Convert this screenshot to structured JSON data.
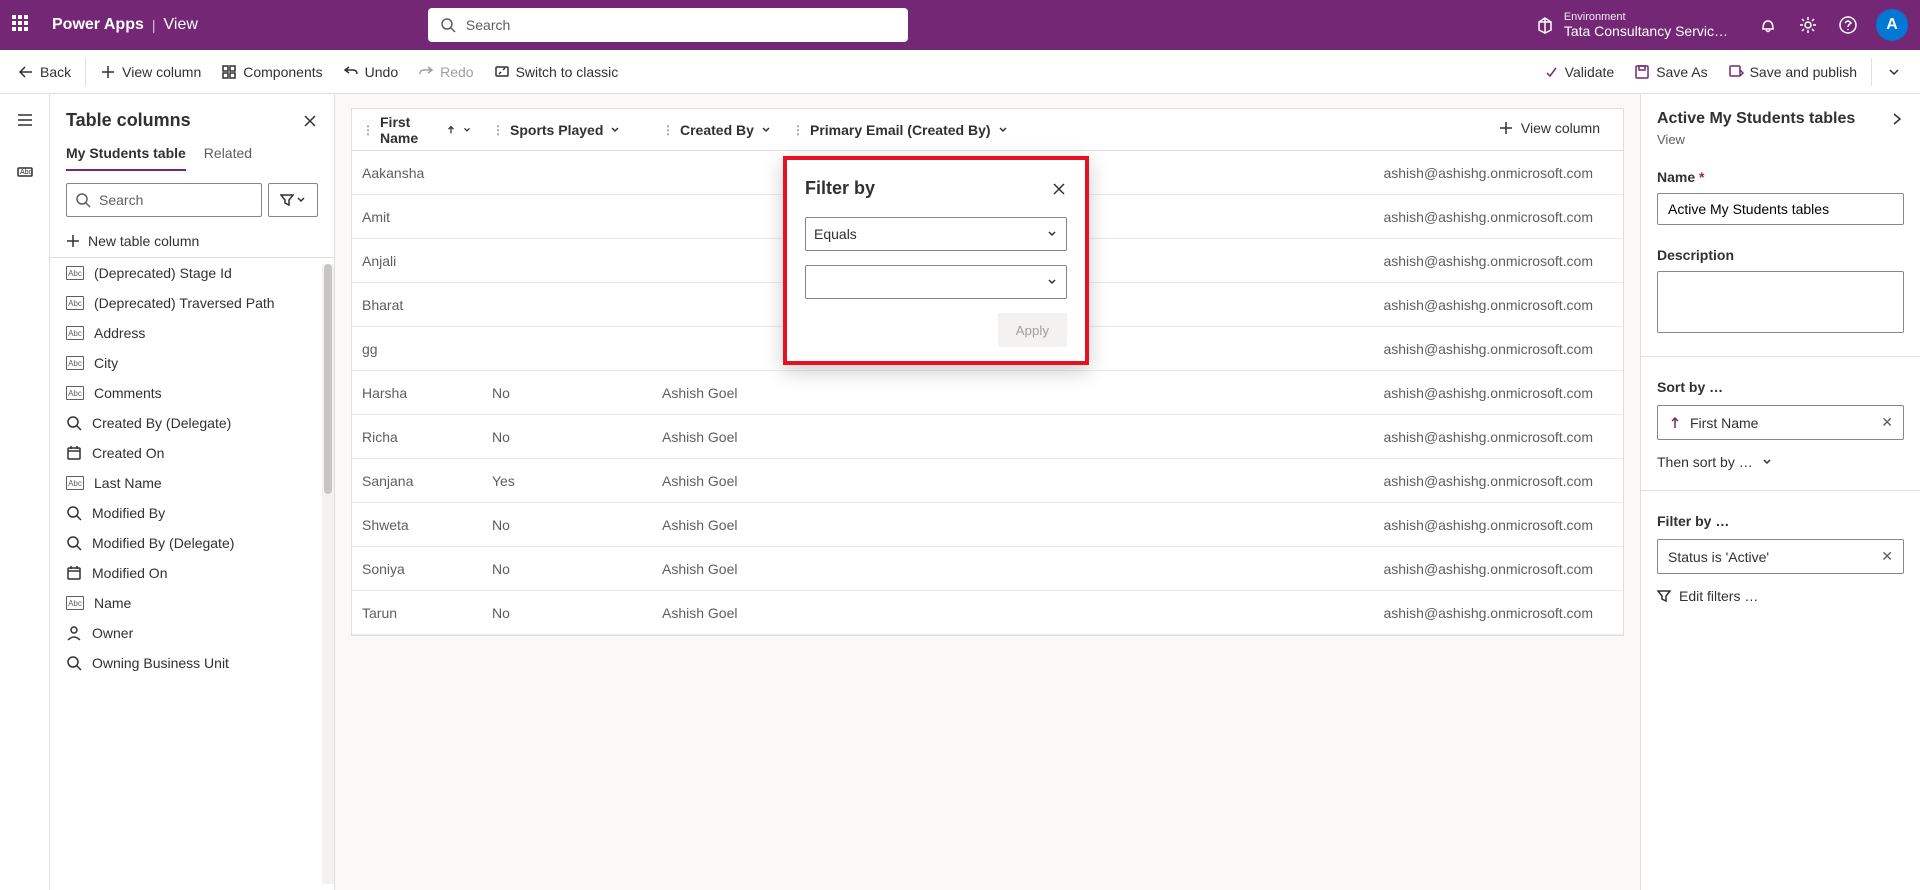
{
  "header": {
    "app": "Power Apps",
    "page": "View",
    "search_placeholder": "Search",
    "env_label": "Environment",
    "env_name": "Tata Consultancy Servic…",
    "avatar": "A"
  },
  "toolbar": {
    "back": "Back",
    "view_column": "View column",
    "components": "Components",
    "undo": "Undo",
    "redo": "Redo",
    "switch": "Switch to classic",
    "validate": "Validate",
    "save_as": "Save As",
    "save_publish": "Save and publish"
  },
  "left": {
    "heading": "Table columns",
    "tab_primary": "My Students table",
    "tab_related": "Related",
    "search_placeholder": "Search",
    "new_col": "New table column",
    "items": [
      {
        "label": "(Deprecated) Stage Id",
        "icon": "abc"
      },
      {
        "label": "(Deprecated) Traversed Path",
        "icon": "abc"
      },
      {
        "label": "Address",
        "icon": "abc"
      },
      {
        "label": "City",
        "icon": "abc"
      },
      {
        "label": "Comments",
        "icon": "abc"
      },
      {
        "label": "Created By (Delegate)",
        "icon": "search"
      },
      {
        "label": "Created On",
        "icon": "cal"
      },
      {
        "label": "Last Name",
        "icon": "abc"
      },
      {
        "label": "Modified By",
        "icon": "search"
      },
      {
        "label": "Modified By (Delegate)",
        "icon": "search"
      },
      {
        "label": "Modified On",
        "icon": "cal"
      },
      {
        "label": "Name",
        "icon": "abc"
      },
      {
        "label": "Owner",
        "icon": "person"
      },
      {
        "label": "Owning Business Unit",
        "icon": "search"
      }
    ]
  },
  "grid": {
    "add_col": "View column",
    "headers": {
      "c1": "First Name",
      "c2": "Sports Played",
      "c3": "Created By",
      "c4": "Primary Email (Created By)"
    },
    "rows": [
      {
        "c1": "Aakansha",
        "c2": "",
        "c3": "",
        "c4": "ashish@ashishg.onmicrosoft.com"
      },
      {
        "c1": "Amit",
        "c2": "",
        "c3": "",
        "c4": "ashish@ashishg.onmicrosoft.com"
      },
      {
        "c1": "Anjali",
        "c2": "",
        "c3": "",
        "c4": "ashish@ashishg.onmicrosoft.com"
      },
      {
        "c1": "Bharat",
        "c2": "",
        "c3": "",
        "c4": "ashish@ashishg.onmicrosoft.com"
      },
      {
        "c1": "gg",
        "c2": "",
        "c3": "",
        "c4": "ashish@ashishg.onmicrosoft.com"
      },
      {
        "c1": "Harsha",
        "c2": "No",
        "c3": "Ashish Goel",
        "c4": "ashish@ashishg.onmicrosoft.com"
      },
      {
        "c1": "Richa",
        "c2": "No",
        "c3": "Ashish Goel",
        "c4": "ashish@ashishg.onmicrosoft.com"
      },
      {
        "c1": "Sanjana",
        "c2": "Yes",
        "c3": "Ashish Goel",
        "c4": "ashish@ashishg.onmicrosoft.com"
      },
      {
        "c1": "Shweta",
        "c2": "No",
        "c3": "Ashish Goel",
        "c4": "ashish@ashishg.onmicrosoft.com"
      },
      {
        "c1": "Soniya",
        "c2": "No",
        "c3": "Ashish Goel",
        "c4": "ashish@ashishg.onmicrosoft.com"
      },
      {
        "c1": "Tarun",
        "c2": "No",
        "c3": "Ashish Goel",
        "c4": "ashish@ashishg.onmicrosoft.com"
      }
    ]
  },
  "popup": {
    "title": "Filter by",
    "operator": "Equals",
    "apply": "Apply"
  },
  "right": {
    "title": "Active My Students tables",
    "type": "View",
    "name_label": "Name",
    "name_value": "Active My Students tables",
    "desc_label": "Description",
    "sort_label": "Sort by …",
    "sort_value": "First Name",
    "then_sort": "Then sort by …",
    "filter_label": "Filter by …",
    "filter_value": "Status is 'Active'",
    "edit_filters": "Edit filters …"
  }
}
